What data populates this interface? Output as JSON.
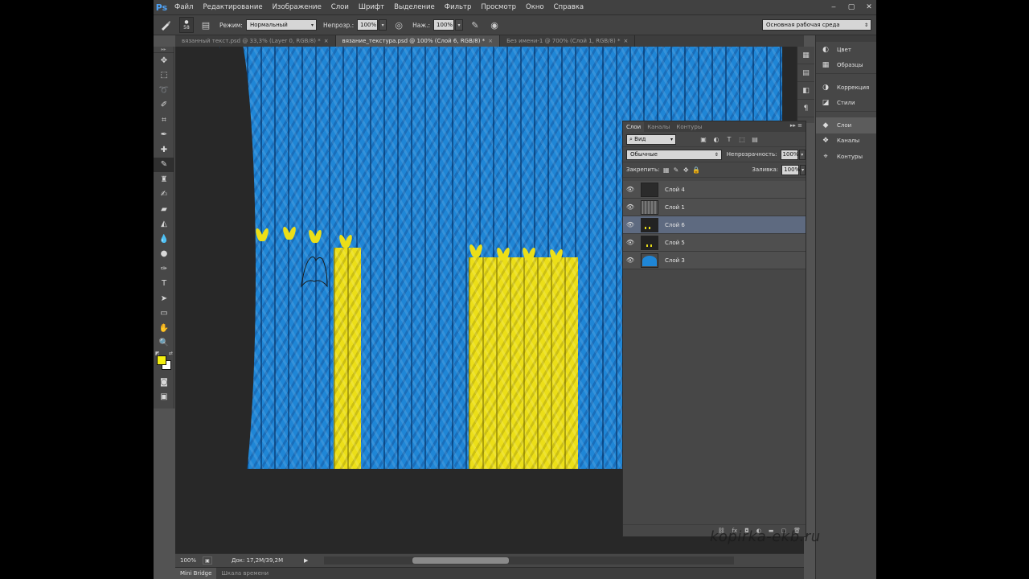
{
  "app": {
    "logo": "Ps",
    "menu": [
      "Файл",
      "Редактирование",
      "Изображение",
      "Слои",
      "Шрифт",
      "Выделение",
      "Фильтр",
      "Просмотр",
      "Окно",
      "Справка"
    ],
    "window_controls": [
      "‒",
      "▢",
      "✕"
    ]
  },
  "options": {
    "brush_size": "58",
    "mode_label": "Режим:",
    "mode_value": "Нормальный",
    "opacity_label": "Непрозр.:",
    "opacity_value": "100%",
    "pressure_label": "Наж.:",
    "pressure_value": "100%",
    "workspace": "Основная рабочая среда"
  },
  "tabs": [
    {
      "label": "вязанный текст.psd @ 33,3% (Layer 0, RGB/8) *",
      "active": false
    },
    {
      "label": "вязание_текстура.psd @ 100% (Слой 6, RGB/8) *",
      "active": true
    },
    {
      "label": "Без имени-1 @ 700% (Слой 1, RGB/8) *",
      "active": false
    }
  ],
  "colors": {
    "foreground": "#f5f010",
    "background": "#ffffff",
    "knit_blue": "#1f86d6",
    "knit_yellow": "#ecdf18"
  },
  "status": {
    "zoom": "100%",
    "doc": "Док: 17,2M/39,2M"
  },
  "bottom_tabs": [
    "Mini Bridge",
    "Шкала времени"
  ],
  "dock": {
    "items": [
      {
        "label": "Цвет",
        "icon": "color-icon"
      },
      {
        "label": "Образцы",
        "icon": "swatches-icon"
      },
      {
        "label": "Коррекция",
        "icon": "adjustments-icon"
      },
      {
        "label": "Стили",
        "icon": "styles-icon"
      },
      {
        "label": "Слои",
        "icon": "layers-icon",
        "active": true
      },
      {
        "label": "Каналы",
        "icon": "channels-icon"
      },
      {
        "label": "Контуры",
        "icon": "paths-icon"
      }
    ]
  },
  "layers_panel": {
    "tabs": [
      "Слои",
      "Каналы",
      "Контуры"
    ],
    "filter": "Вид",
    "blend_mode": "Обычные",
    "opacity_label": "Непрозрачность:",
    "opacity_value": "100%",
    "lock_label": "Закрепить:",
    "fill_label": "Заливка:",
    "fill_value": "100%",
    "layers": [
      {
        "name": "Слой 4",
        "thumb": "dark"
      },
      {
        "name": "Слой 1",
        "thumb": "texture"
      },
      {
        "name": "Слой 6",
        "thumb": "dark-yellow",
        "selected": true
      },
      {
        "name": "Слой 5",
        "thumb": "dark-yellow"
      },
      {
        "name": "Слой 3",
        "thumb": "blue"
      }
    ]
  },
  "watermark": "kopirka-ekb.ru"
}
